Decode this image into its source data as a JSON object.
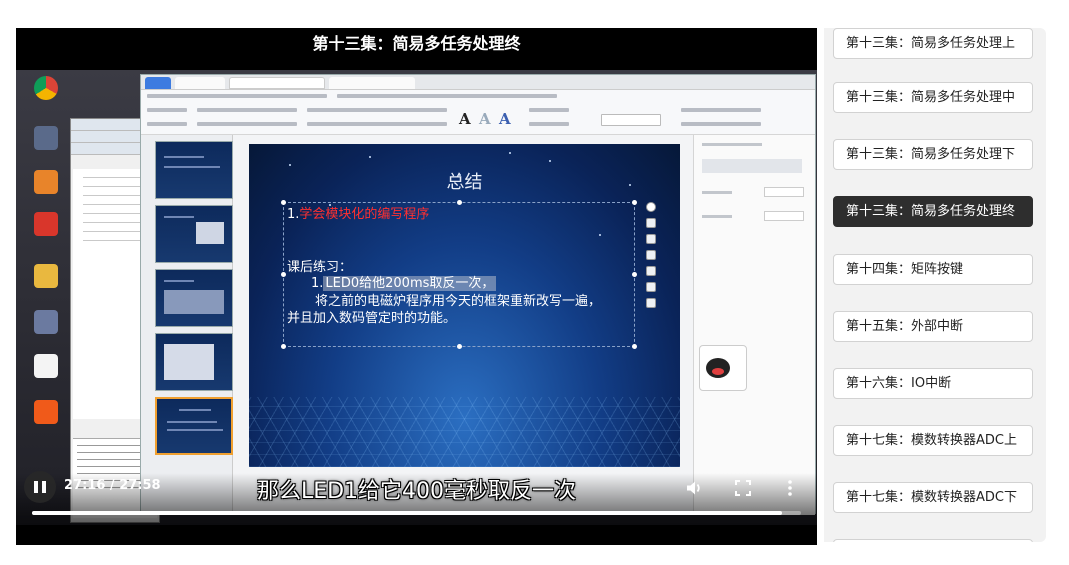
{
  "video": {
    "title": "第十三集：简易多任务处理终",
    "slide": {
      "title": "总结",
      "point1_num": "1.",
      "point1_text": "学会模块化的编写程序",
      "practice_label": "课后练习：",
      "ex1_prefix": "1.",
      "ex1_text": "LED0给他200ms取反一次，",
      "ex2_text": "将之前的电磁炉程序用今天的框架重新改写一遍，",
      "ex3_text": "并且加入数码管定时的功能。"
    },
    "subtitle": "那么LED1给它400毫秒取反一次",
    "current_time": "27:16",
    "duration": "27:58",
    "time_separator": " / ",
    "progress": 0.975
  },
  "playlist": {
    "items": [
      {
        "label": "第十三集：简易多任务处理上",
        "active": false
      },
      {
        "label": "第十三集：简易多任务处理中",
        "active": false
      },
      {
        "label": "第十三集：简易多任务处理下",
        "active": false
      },
      {
        "label": "第十三集：简易多任务处理终",
        "active": true
      },
      {
        "label": "第十四集：矩阵按键",
        "active": false
      },
      {
        "label": "第十五集：外部中断",
        "active": false
      },
      {
        "label": "第十六集：IO中断",
        "active": false
      },
      {
        "label": "第十七集：模数转换器ADC上",
        "active": false
      },
      {
        "label": "第十七集：模数转换器ADC下",
        "active": false
      }
    ]
  },
  "icons": {
    "play_pause": "pause-icon",
    "volume": "volume-icon",
    "fullscreen": "fullscreen-icon",
    "more": "more-vertical-icon"
  },
  "colors": {
    "active_item_bg": "#2e2e2e",
    "slide_highlight_text": "#ff3030"
  }
}
